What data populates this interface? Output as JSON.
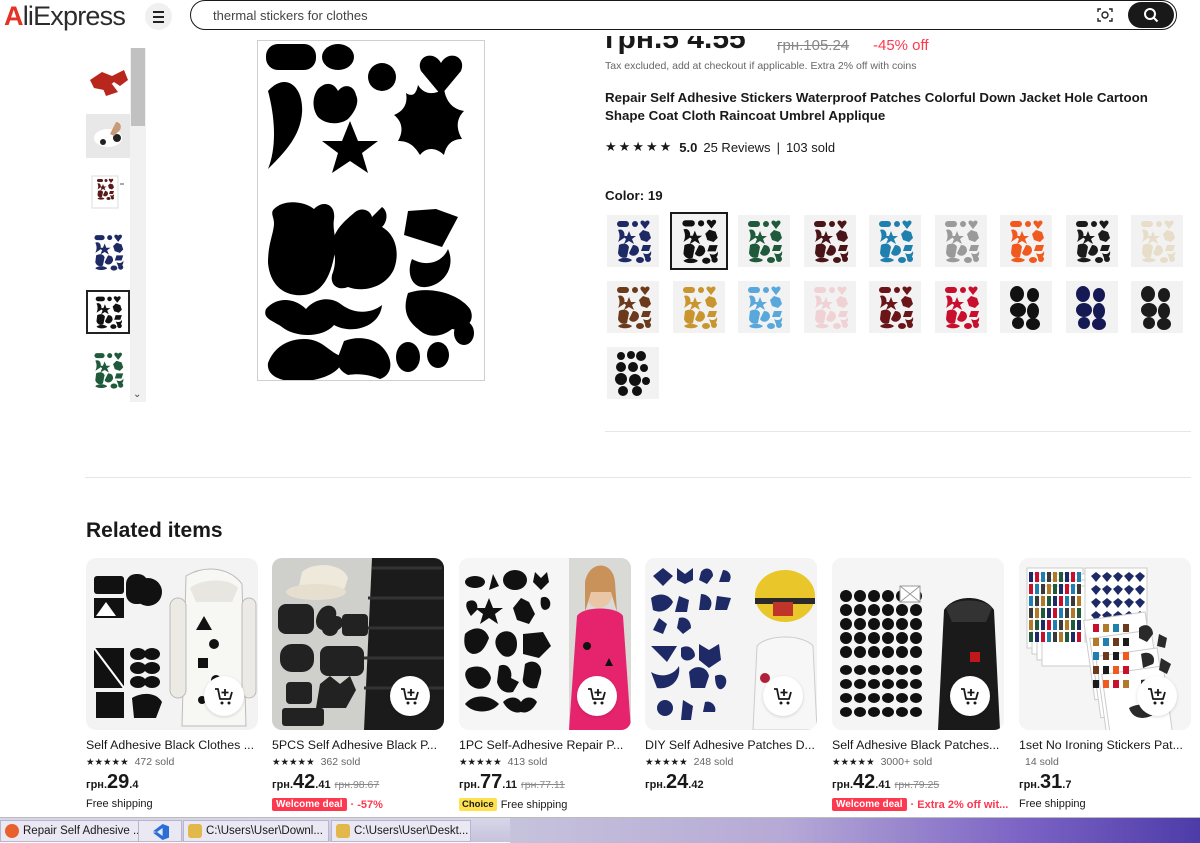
{
  "header": {
    "logo_first": "A",
    "logo_rest": "liExpress",
    "search_query": "thermal stickers for clothes"
  },
  "product": {
    "price_big": "грн.5 4.55",
    "price_old": "грн.105.24",
    "discount": "-45% off",
    "tax_note": "Tax excluded, add at checkout if applicable. Extra 2% off with coins",
    "title": "Repair Self Adhesive Stickers Waterproof Patches Colorful Down Jacket Hole Cartoon Shape Coat Cloth Raincoat Umbrel Applique",
    "rating": "5.0",
    "reviews": "25 Reviews",
    "sold": "103 sold",
    "color_label": "Color: 19",
    "swatches": [
      {
        "color": "#1e2a66",
        "style": "shapes"
      },
      {
        "color": "#111111",
        "style": "shapes",
        "selected": true
      },
      {
        "color": "#1f5a3a",
        "style": "shapes"
      },
      {
        "color": "#4a1518",
        "style": "shapes"
      },
      {
        "color": "#1f7fae",
        "style": "shapes"
      },
      {
        "color": "#9a9a9a",
        "style": "shapes"
      },
      {
        "color": "#f05a1e",
        "style": "shapes"
      },
      {
        "color": "#1b1b1b",
        "style": "shapes"
      },
      {
        "color": "#e8ddc9",
        "style": "shapes"
      },
      {
        "color": "#6b3a1c",
        "style": "shapes"
      },
      {
        "color": "#c9952e",
        "style": "shapes"
      },
      {
        "color": "#58a8dc",
        "style": "shapes"
      },
      {
        "color": "#f1d2d4",
        "style": "shapes"
      },
      {
        "color": "#6a1518",
        "style": "shapes"
      },
      {
        "color": "#c8102e",
        "style": "shapes"
      },
      {
        "color": "#111111",
        "style": "ovals"
      },
      {
        "color": "#151a55",
        "style": "ovals"
      },
      {
        "color": "#1b1b1b",
        "style": "ovals"
      },
      {
        "color": "#111111",
        "style": "dots"
      }
    ]
  },
  "thumbnails": [
    {
      "name": "thumb-red-patches",
      "color": "#b8261e"
    },
    {
      "name": "thumb-hand-applying",
      "color": "#222222"
    },
    {
      "name": "thumb-size-chart",
      "color": "#5a1a1a"
    },
    {
      "name": "thumb-navy-patches",
      "color": "#1e2a66"
    },
    {
      "name": "thumb-black-patches",
      "color": "#111111",
      "selected": true
    },
    {
      "name": "thumb-green-patches",
      "color": "#1f5a3a"
    }
  ],
  "related": {
    "title": "Related items",
    "items": [
      {
        "name": "Self Adhesive Black Clothes ...",
        "stars": "★★★★★",
        "sold": "472 sold",
        "cur": "грн.",
        "main": "29",
        "dec": ".4",
        "was": "",
        "badge": "",
        "extra": "",
        "ship": "Free shipping"
      },
      {
        "name": "5PCS Self Adhesive Black P...",
        "stars": "★★★★★",
        "sold": "362 sold",
        "cur": "грн.",
        "main": "42",
        "dec": ".41",
        "was": "грн.98.67",
        "badge": "Welcome deal",
        "extra": "-57%",
        "ship": ""
      },
      {
        "name": "1PC Self-Adhesive Repair P...",
        "stars": "★★★★★",
        "sold": "413 sold",
        "cur": "грн.",
        "main": "77",
        "dec": ".11",
        "was": "грн.77.11",
        "badge_choice": "Choice",
        "badge": "",
        "extra": "",
        "ship": "Free shipping"
      },
      {
        "name": "DIY Self Adhesive Patches D...",
        "stars": "★★★★★",
        "sold": "248 sold",
        "cur": "грн.",
        "main": "24",
        "dec": ".42",
        "was": "",
        "badge": "",
        "extra": "",
        "ship": ""
      },
      {
        "name": "Self Adhesive Black Patches...",
        "stars": "★★★★★",
        "sold": "3000+ sold",
        "cur": "грн.",
        "main": "42",
        "dec": ".41",
        "was": "грн.79.25",
        "badge": "Welcome deal",
        "extra": "Extra 2% off wit...",
        "ship": ""
      },
      {
        "name": "1set No Ironing Stickers Pat...",
        "stars": "",
        "sold": "14 sold",
        "cur": "грн.",
        "main": "31",
        "dec": ".7",
        "was": "",
        "badge": "",
        "extra": "",
        "ship": "Free shipping"
      }
    ]
  },
  "taskbar": {
    "items": [
      {
        "label": "Repair Self Adhesive ...",
        "icon_color": "#e8612c"
      },
      {
        "label": "",
        "icon_color": "#2a6fd6"
      },
      {
        "label": "C:\\Users\\User\\Downl...",
        "icon_color": "#e2b84a"
      },
      {
        "label": "C:\\Users\\User\\Deskt...",
        "icon_color": "#e2b84a"
      }
    ]
  }
}
